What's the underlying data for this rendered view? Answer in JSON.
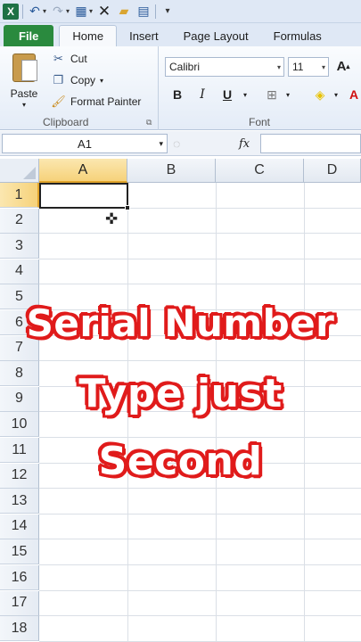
{
  "quick_access": {
    "icons": [
      "excel-icon",
      "undo-icon",
      "redo-icon",
      "table-icon",
      "close-icon",
      "open-folder-icon",
      "form-icon",
      "customize-icon"
    ]
  },
  "tabs": [
    {
      "label": "File"
    },
    {
      "label": "Home"
    },
    {
      "label": "Insert"
    },
    {
      "label": "Page Layout"
    },
    {
      "label": "Formulas"
    }
  ],
  "clipboard": {
    "paste_label": "Paste",
    "cut_label": "Cut",
    "copy_label": "Copy",
    "format_painter_label": "Format Painter",
    "group_label": "Clipboard"
  },
  "font": {
    "font_name": "Calibri",
    "font_size": "11",
    "bold": "B",
    "italic": "I",
    "underline": "U",
    "group_label": "Font"
  },
  "formula_bar": {
    "name_box": "A1",
    "fx": "fx",
    "formula": ""
  },
  "grid": {
    "columns": [
      "A",
      "B",
      "C",
      "D"
    ],
    "rows": [
      "1",
      "2",
      "3",
      "4",
      "5",
      "6",
      "7",
      "8",
      "9",
      "10",
      "11",
      "12",
      "13",
      "14",
      "15",
      "16",
      "17",
      "18"
    ],
    "active_cell": "A1"
  },
  "caption": {
    "line1": "Serial Number",
    "line2": "Type just",
    "line3": "Second"
  },
  "colors": {
    "accent": "#2a8a3e",
    "caption_outline": "#e01b1b",
    "selected_header": "#f6d27a"
  }
}
